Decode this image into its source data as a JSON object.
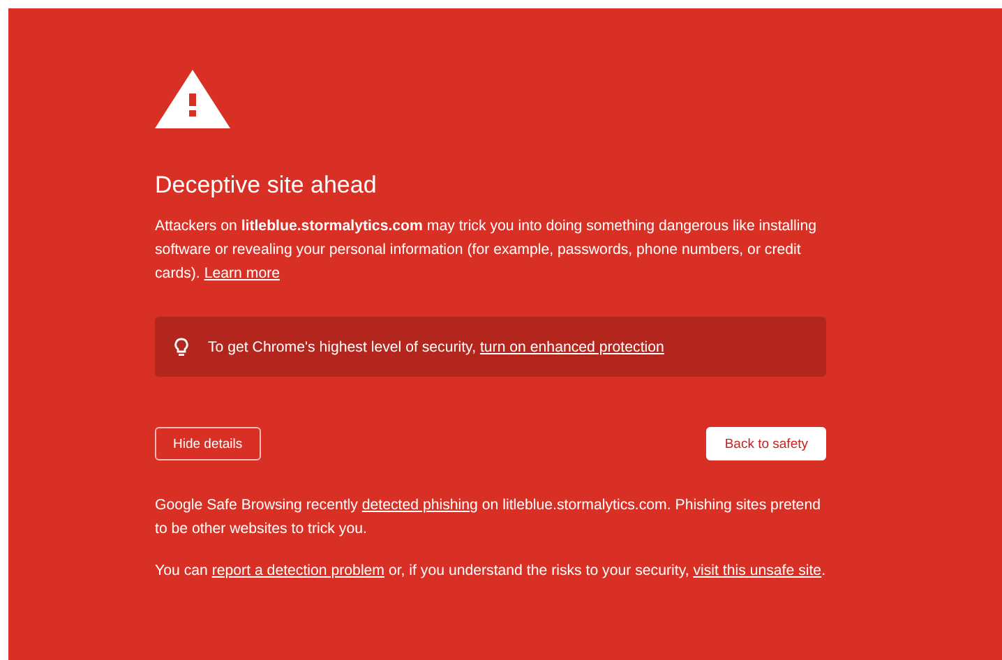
{
  "heading": "Deceptive site ahead",
  "intro": [
    {
      "kind": "text",
      "text": "Attackers on **litleblue.stormalytics.com** may trick you into doing something dangerous like installing software or revealing your personal information (for example, passwords, phone numbers, or credit cards). "
    },
    {
      "kind": "link",
      "text": "Learn more"
    }
  ],
  "tip": [
    {
      "kind": "text",
      "text": "To get Chrome's highest level of security, "
    },
    {
      "kind": "link",
      "text": "turn on enhanced protection"
    }
  ],
  "buttons": {
    "details": "Hide details",
    "safety": "Back to safety"
  },
  "details": [
    [
      {
        "kind": "text",
        "text": "Google Safe Browsing recently "
      },
      {
        "kind": "link",
        "text": "detected phishing"
      },
      {
        "kind": "text",
        "text": " on litleblue.stormalytics.com. Phishing sites pretend to be other websites to trick you."
      }
    ],
    [
      {
        "kind": "text",
        "text": "You can "
      },
      {
        "kind": "link",
        "text": "report a detection problem"
      },
      {
        "kind": "text",
        "text": " or, if you understand the risks to your security, "
      },
      {
        "kind": "link",
        "text": "visit this unsafe site"
      },
      {
        "kind": "text",
        "text": "."
      }
    ]
  ]
}
